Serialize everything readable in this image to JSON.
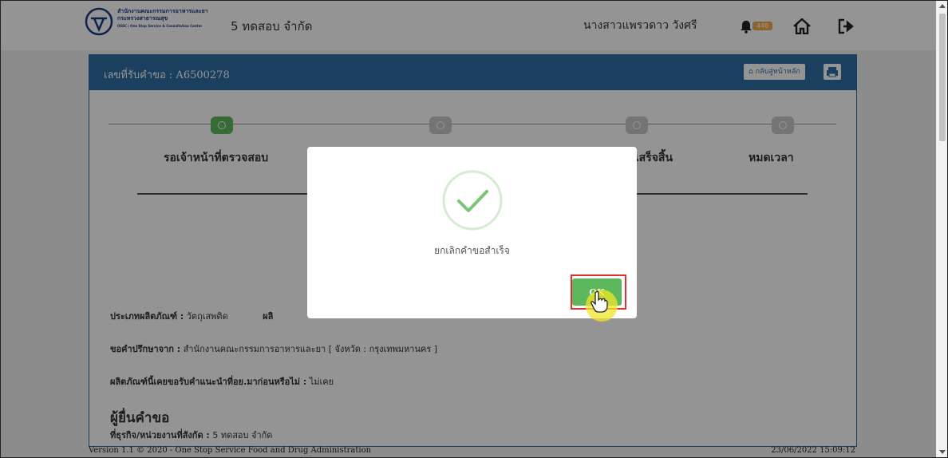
{
  "header": {
    "logo_org_th": "สำนักงานคณะกรรมการอาหารและยา",
    "logo_ministry_th": "กระทรวงสาธารณสุข",
    "logo_en": "OSSC | One Stop Service & Consultation Center",
    "company": "5 ทดสอบ จำกัด",
    "username": "นางสาวแพรวดาว วังศรี",
    "notification_count": "448"
  },
  "panel": {
    "request_no": "เลขที่รับคำขอ : A6500278",
    "back_label": "กลับสู่หน้าหลัก"
  },
  "steps": [
    "รอเจ้าหน้าที่ตรวจสอบ",
    "",
    "การเสร็จสิ้น",
    "หมดเวลา"
  ],
  "fields": {
    "product_type_label": "ประเภทผลิตภัณฑ์ :",
    "product_type_value": "วัตถุเสพติด",
    "product_label_partial": "ผลิ",
    "consult_from_label": "ขอคำปรึกษาจาก :",
    "consult_from_value": "สำนักงานคณะกรรมการอาหารและยา [ จังหวัด : กรุงเทพมหานคร ]",
    "prior_advice_label": "ผลิตภัณฑ์นี้เคยขอรับคำแนะนำที่อย.มาก่อนหรือไม่ :",
    "prior_advice_value": "ไม่เคย",
    "applicant_section": "ผู้ยื่นคำขอ",
    "business_label": "ที่ธุรกิจ/หน่วยงานที่สังกัด :",
    "business_value": "5 ทดสอบ จำกัด"
  },
  "modal": {
    "message": "ยกเลิกคำขอสำเร็จ",
    "ok_label": "OK"
  },
  "footer": {
    "version": "Version 1.1 © 2020 - One Stop Service Food and Drug Administration",
    "timestamp": "23/06/2022 15:09:12"
  },
  "colors": {
    "primary": "#2f6da3",
    "success": "#5cb85c",
    "badge": "#f0ad4e",
    "highlight": "#e03030"
  }
}
